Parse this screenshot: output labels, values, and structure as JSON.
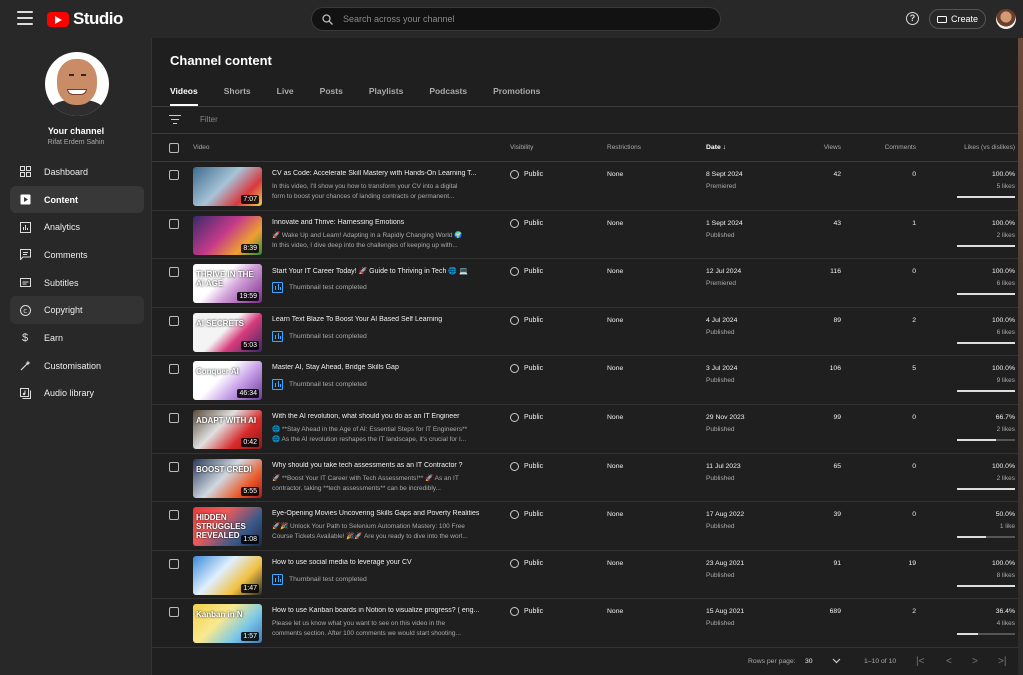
{
  "header": {
    "logo_text": "Studio",
    "search_placeholder": "Search across your channel",
    "help_icon": "?",
    "create_label": "Create"
  },
  "sidebar": {
    "channel_title": "Your channel",
    "channel_name": "Rifat Erdem Sahin",
    "items": [
      {
        "label": "Dashboard",
        "icon": "dashboard-icon"
      },
      {
        "label": "Content",
        "icon": "content-icon",
        "active": true
      },
      {
        "label": "Analytics",
        "icon": "analytics-icon"
      },
      {
        "label": "Comments",
        "icon": "comments-icon"
      },
      {
        "label": "Subtitles",
        "icon": "subtitles-icon"
      },
      {
        "label": "Copyright",
        "icon": "copyright-icon"
      },
      {
        "label": "Earn",
        "icon": "earn-icon"
      },
      {
        "label": "Customisation",
        "icon": "customisation-icon"
      },
      {
        "label": "Audio library",
        "icon": "audio-library-icon"
      }
    ]
  },
  "main": {
    "title": "Channel content",
    "tabs": [
      "Videos",
      "Shorts",
      "Live",
      "Posts",
      "Playlists",
      "Podcasts",
      "Promotions"
    ],
    "filter_placeholder": "Filter",
    "columns": {
      "video": "Video",
      "visibility": "Visibility",
      "restrictions": "Restrictions",
      "date": "Date",
      "views": "Views",
      "comments": "Comments",
      "likes": "Likes (vs dislikes)"
    },
    "rows": [
      {
        "title": "CV as Code: Accelerate Skill Mastery with Hands-On Learning T...",
        "desc": "In this video, I'll show you how to transform your CV into a digital\nform to boost your chances of landing contracts or permanent...",
        "thumbtest": "",
        "duration": "7:07",
        "thumb_caption": "",
        "visibility": "Public",
        "restrictions": "None",
        "date": "8 Sept 2024",
        "date_status": "Premiered",
        "views": "42",
        "comments": "0",
        "likes_pct": "100.0%",
        "likes_count": "5 likes",
        "likes_fraction": 1.0
      },
      {
        "title": "Innovate and Thrive: Harnessing Emotions",
        "desc": "🚀 Wake Up and Learn! Adapting in a Rapidly Changing World 🌍\nIn this video, I dive deep into the challenges of keeping up with...",
        "thumbtest": "",
        "duration": "8:39",
        "thumb_caption": "",
        "visibility": "Public",
        "restrictions": "None",
        "date": "1 Sept 2024",
        "date_status": "Published",
        "views": "43",
        "comments": "1",
        "likes_pct": "100.0%",
        "likes_count": "2 likes",
        "likes_fraction": 1.0
      },
      {
        "title": "Start Your IT Career Today! 🚀 Guide to Thriving in Tech 🌐 💻",
        "desc": "",
        "thumbtest": "Thumbnail test completed",
        "duration": "19:59",
        "thumb_caption": "THRIVE IN THE AI AGE",
        "visibility": "Public",
        "restrictions": "None",
        "date": "12 Jul 2024",
        "date_status": "Premiered",
        "views": "116",
        "comments": "0",
        "likes_pct": "100.0%",
        "likes_count": "6 likes",
        "likes_fraction": 1.0
      },
      {
        "title": "Learn Text Blaze To Boost Your AI Based Self Learning",
        "desc": "",
        "thumbtest": "Thumbnail test completed",
        "duration": "5:03",
        "thumb_caption": "AI SECRETS",
        "visibility": "Public",
        "restrictions": "None",
        "date": "4 Jul 2024",
        "date_status": "Published",
        "views": "89",
        "comments": "2",
        "likes_pct": "100.0%",
        "likes_count": "6 likes",
        "likes_fraction": 1.0
      },
      {
        "title": "Master AI, Stay Ahead, Bridge Skills Gap",
        "desc": "",
        "thumbtest": "Thumbnail test completed",
        "duration": "46:34",
        "thumb_caption": "Conquer AI",
        "visibility": "Public",
        "restrictions": "None",
        "date": "3 Jul 2024",
        "date_status": "Published",
        "views": "106",
        "comments": "5",
        "likes_pct": "100.0%",
        "likes_count": "9 likes",
        "likes_fraction": 1.0
      },
      {
        "title": "With the AI revolution, what should you do as an IT Engineer",
        "desc": "🌐 **Stay Ahead in the Age of AI: Essential Steps for IT Engineers**\n🌐 As the AI revolution reshapes the IT landscape, it's crucial for I...",
        "thumbtest": "",
        "duration": "0:42",
        "thumb_caption": "ADAPT WITH AI",
        "visibility": "Public",
        "restrictions": "None",
        "date": "29 Nov 2023",
        "date_status": "Published",
        "views": "99",
        "comments": "0",
        "likes_pct": "66.7%",
        "likes_count": "2 likes",
        "likes_fraction": 0.667
      },
      {
        "title": "Why should you take tech assessments as an IT Contractor ?",
        "desc": "🚀 **Boost Your IT Career with Tech Assessments!** 🚀 As an IT\ncontractor, taking **tech assessments** can be incredibly...",
        "thumbtest": "",
        "duration": "5:55",
        "thumb_caption": "BOOST CREDI",
        "visibility": "Public",
        "restrictions": "None",
        "date": "11 Jul 2023",
        "date_status": "Published",
        "views": "65",
        "comments": "0",
        "likes_pct": "100.0%",
        "likes_count": "2 likes",
        "likes_fraction": 1.0
      },
      {
        "title": "Eye-Opening Movies Uncovering Skills Gaps and Poverty Realities",
        "desc": "🚀🎉 Unlock Your Path to Selenium Automation Mastery: 100 Free\nCourse Tickets Available! 🎉🚀 Are you ready to dive into the worl...",
        "thumbtest": "",
        "duration": "1:08",
        "thumb_caption": "HIDDEN STRUGGLES REVEALED",
        "visibility": "Public",
        "restrictions": "None",
        "date": "17 Aug 2022",
        "date_status": "Published",
        "views": "39",
        "comments": "0",
        "likes_pct": "50.0%",
        "likes_count": "1 like",
        "likes_fraction": 0.5
      },
      {
        "title": "How to use social media to leverage your CV",
        "desc": "",
        "thumbtest": "Thumbnail test completed",
        "duration": "1:47",
        "thumb_caption": "",
        "visibility": "Public",
        "restrictions": "None",
        "date": "23 Aug 2021",
        "date_status": "Published",
        "views": "91",
        "comments": "19",
        "likes_pct": "100.0%",
        "likes_count": "8 likes",
        "likes_fraction": 1.0
      },
      {
        "title": "How to use Kanban boards in Notion to visualize progress? ( eng...",
        "desc": "Please let us know what you want to see on this video in the\ncomments section. After 100 comments we would start shooting...",
        "thumbtest": "",
        "duration": "1:57",
        "thumb_caption": "Kanban in N",
        "visibility": "Public",
        "restrictions": "None",
        "date": "15 Aug 2021",
        "date_status": "Published",
        "views": "689",
        "comments": "2",
        "likes_pct": "36.4%",
        "likes_count": "4 likes",
        "likes_fraction": 0.364
      }
    ],
    "footer": {
      "rows_per_page_label": "Rows per page:",
      "rows_per_page_value": "30",
      "range": "1–10 of 10"
    }
  }
}
